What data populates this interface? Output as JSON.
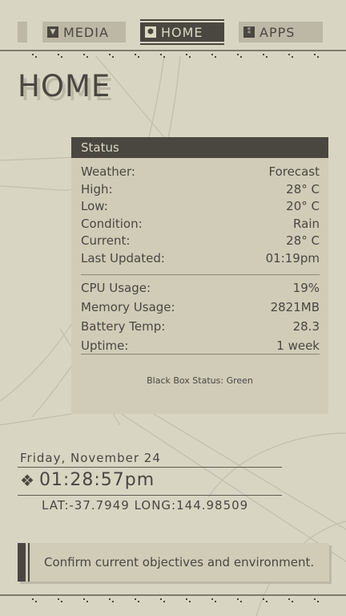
{
  "nav": {
    "tabs": [
      {
        "label": "MEDIA",
        "icon": "media-icon"
      },
      {
        "label": "HOME",
        "icon": "home-icon",
        "active": true
      },
      {
        "label": "APPS",
        "icon": "apps-icon"
      }
    ]
  },
  "page_title": "HOME",
  "status": {
    "title": "Status",
    "weather": [
      {
        "label": "Weather:",
        "value": "Forecast"
      },
      {
        "label": "High:",
        "value": "28° C"
      },
      {
        "label": "Low:",
        "value": "20° C"
      },
      {
        "label": "Condition:",
        "value": "Rain"
      },
      {
        "label": "Current:",
        "value": "28° C"
      },
      {
        "label": "Last Updated:",
        "value": "01:19pm"
      }
    ],
    "system": [
      {
        "label": "CPU Usage:",
        "value": "19%"
      },
      {
        "label": "Memory Usage:",
        "value": "2821MB"
      },
      {
        "label": "Battery Temp:",
        "value": "28.3"
      },
      {
        "label": "Uptime:",
        "value": "1 week"
      }
    ],
    "black_box": "Black Box Status: Green"
  },
  "clock": {
    "date": "Friday, November 24",
    "time": "01:28:57pm",
    "latlong": "LAT:-37.7949 LONG:144.98509"
  },
  "objective": "Confirm current objectives and environment.",
  "colors": {
    "background": "#d9d5c3",
    "dark": "#4a4740",
    "panel": "#d0ccb8"
  }
}
